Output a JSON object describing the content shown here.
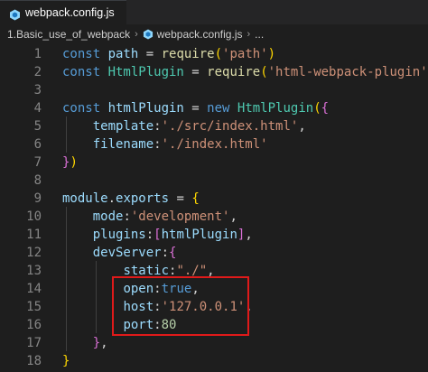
{
  "tab": {
    "title": "webpack.config.js",
    "icon": "webpack-file-icon"
  },
  "breadcrumb": {
    "folder": "1.Basic_use_of_webpack",
    "file": "webpack.config.js",
    "ellipsis": "..."
  },
  "lines": [
    {
      "n": "1",
      "tokens": [
        [
          "kw",
          "const "
        ],
        [
          "var",
          "path"
        ],
        [
          "p",
          " = "
        ],
        [
          "fn",
          "require"
        ],
        [
          "b1",
          "("
        ],
        [
          "str",
          "'path'"
        ],
        [
          "b1",
          ")"
        ]
      ]
    },
    {
      "n": "2",
      "tokens": [
        [
          "kw",
          "const "
        ],
        [
          "cls",
          "HtmlPlugin"
        ],
        [
          "p",
          " = "
        ],
        [
          "fn",
          "require"
        ],
        [
          "b1",
          "("
        ],
        [
          "str",
          "'html-webpack-plugin'"
        ],
        [
          "b1",
          ")"
        ]
      ]
    },
    {
      "n": "3",
      "tokens": []
    },
    {
      "n": "4",
      "tokens": [
        [
          "kw",
          "const "
        ],
        [
          "var",
          "htmlPlugin"
        ],
        [
          "p",
          " = "
        ],
        [
          "kw",
          "new "
        ],
        [
          "cls",
          "HtmlPlugin"
        ],
        [
          "b1",
          "("
        ],
        [
          "b2",
          "{"
        ]
      ]
    },
    {
      "n": "5",
      "tokens": [
        [
          "p",
          "    "
        ],
        [
          "var",
          "template"
        ],
        [
          "p",
          ":"
        ],
        [
          "str",
          "'./src/index.html'"
        ],
        [
          "p",
          ","
        ]
      ]
    },
    {
      "n": "6",
      "tokens": [
        [
          "p",
          "    "
        ],
        [
          "var",
          "filename"
        ],
        [
          "p",
          ":"
        ],
        [
          "str",
          "'./index.html'"
        ]
      ]
    },
    {
      "n": "7",
      "tokens": [
        [
          "b2",
          "}"
        ],
        [
          "b1",
          ")"
        ]
      ]
    },
    {
      "n": "8",
      "tokens": []
    },
    {
      "n": "9",
      "tokens": [
        [
          "var",
          "module"
        ],
        [
          "p",
          "."
        ],
        [
          "var",
          "exports"
        ],
        [
          "p",
          " = "
        ],
        [
          "b1",
          "{"
        ]
      ]
    },
    {
      "n": "10",
      "tokens": [
        [
          "p",
          "    "
        ],
        [
          "var",
          "mode"
        ],
        [
          "p",
          ":"
        ],
        [
          "str",
          "'development'"
        ],
        [
          "p",
          ","
        ]
      ]
    },
    {
      "n": "11",
      "tokens": [
        [
          "p",
          "    "
        ],
        [
          "var",
          "plugins"
        ],
        [
          "p",
          ":"
        ],
        [
          "b2",
          "["
        ],
        [
          "var",
          "htmlPlugin"
        ],
        [
          "b2",
          "]"
        ],
        [
          "p",
          ","
        ]
      ]
    },
    {
      "n": "12",
      "tokens": [
        [
          "p",
          "    "
        ],
        [
          "var",
          "devServer"
        ],
        [
          "p",
          ":"
        ],
        [
          "b2",
          "{"
        ]
      ]
    },
    {
      "n": "13",
      "tokens": [
        [
          "p",
          "        "
        ],
        [
          "var",
          "static"
        ],
        [
          "p",
          ":"
        ],
        [
          "str",
          "\"./\""
        ],
        [
          "p",
          ","
        ]
      ]
    },
    {
      "n": "14",
      "tokens": [
        [
          "p",
          "        "
        ],
        [
          "var",
          "open"
        ],
        [
          "p",
          ":"
        ],
        [
          "bool",
          "true"
        ],
        [
          "p",
          ","
        ]
      ]
    },
    {
      "n": "15",
      "tokens": [
        [
          "p",
          "        "
        ],
        [
          "var",
          "host"
        ],
        [
          "p",
          ":"
        ],
        [
          "str",
          "'127.0.0.1'"
        ],
        [
          "p",
          ","
        ]
      ]
    },
    {
      "n": "16",
      "tokens": [
        [
          "p",
          "        "
        ],
        [
          "var",
          "port"
        ],
        [
          "p",
          ":"
        ],
        [
          "num",
          "80"
        ]
      ]
    },
    {
      "n": "17",
      "tokens": [
        [
          "p",
          "    "
        ],
        [
          "b2",
          "}"
        ],
        [
          "p",
          ","
        ]
      ]
    },
    {
      "n": "18",
      "tokens": [
        [
          "b1",
          "}"
        ]
      ]
    }
  ],
  "colors": {
    "background": "#1e1e1e",
    "highlight_box": "#e01a1a",
    "keyword": "#569cd6",
    "string": "#ce9178",
    "function": "#dcdcaa",
    "class": "#4ec9b0",
    "number": "#b5cea8",
    "variable": "#9cdcfe"
  }
}
